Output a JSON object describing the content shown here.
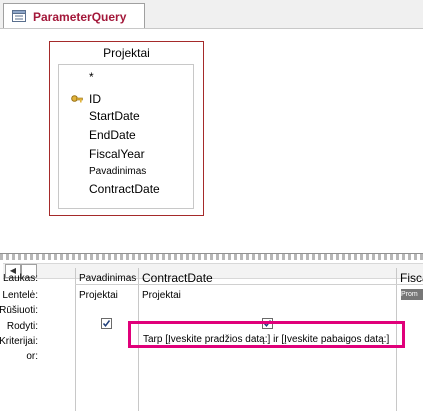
{
  "tab": {
    "title": "ParameterQuery"
  },
  "table": {
    "name": "Projektai",
    "fields": [
      "*",
      "ID",
      "StartDate",
      "EndDate",
      "FiscalYear",
      "Pavadinimas",
      "ContractDate"
    ]
  },
  "grid": {
    "row_labels": [
      "Laukas:",
      "Lentelė:",
      "Rūšiuoti:",
      "Rodyti:",
      "Kriterijai:",
      "or:"
    ],
    "columns": [
      {
        "field": "Pavadinimas",
        "table": "Projektai",
        "show": true,
        "criteria": ""
      },
      {
        "field": "ContractDate",
        "table": "Projektai",
        "show": true,
        "criteria": "Tarp [Įveskite pradžios datą:] ir [Įveskite pabaigos datą:]"
      },
      {
        "field": "Fisca",
        "table": "Prom",
        "show": false,
        "criteria": ""
      }
    ]
  },
  "colors": {
    "tab_title": "#a3183a",
    "table_border": "#a52a2a",
    "highlight": "#e0007a"
  },
  "icons": {
    "tab": "query-icon",
    "primary_key": "key-icon",
    "scroll_left": "scroll-left-icon"
  }
}
